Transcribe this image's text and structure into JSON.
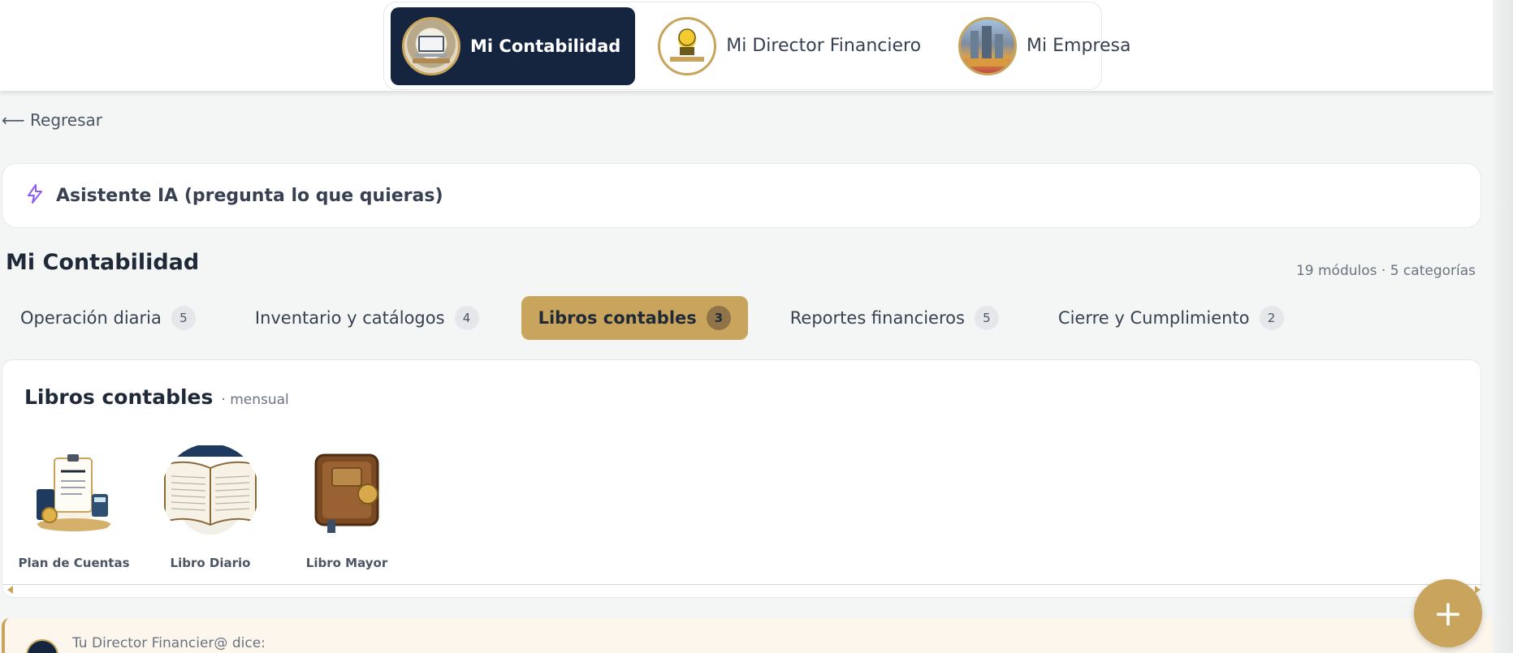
{
  "header": {
    "apps": [
      {
        "label": "Mi Contabilidad",
        "active": true
      },
      {
        "label": "Mi Director Financiero",
        "active": false
      },
      {
        "label": "Mi Empresa",
        "active": false
      }
    ]
  },
  "nav": {
    "back_label": "⟵ Regresar"
  },
  "assistant": {
    "label": "Asistente IA (pregunta lo que quieras)",
    "icon": "bolt-icon"
  },
  "page": {
    "title": "Mi Contabilidad",
    "meta": "19 módulos · 5 categorías"
  },
  "tabs": [
    {
      "label": "Operación diaria",
      "count": "5",
      "active": false
    },
    {
      "label": "Inventario y catálogos",
      "count": "4",
      "active": false
    },
    {
      "label": "Libros contables",
      "count": "3",
      "active": true
    },
    {
      "label": "Reportes financieros",
      "count": "5",
      "active": false
    },
    {
      "label": "Cierre y Cumplimiento",
      "count": "2",
      "active": false
    }
  ],
  "section": {
    "title": "Libros contables",
    "subtitle": "· mensual",
    "modules": [
      {
        "label": "Plan de Cuentas",
        "icon": "plan-de-cuentas-icon"
      },
      {
        "label": "Libro Diario",
        "icon": "libro-diario-icon"
      },
      {
        "label": "Libro Mayor",
        "icon": "libro-mayor-icon"
      }
    ]
  },
  "director_note": {
    "text": "Tu Director Financier@ dice:"
  },
  "fab": {
    "label": "+"
  },
  "colors": {
    "accent": "#c9a45c",
    "navy": "#15253f",
    "ai_icon": "#8b5cf6"
  }
}
